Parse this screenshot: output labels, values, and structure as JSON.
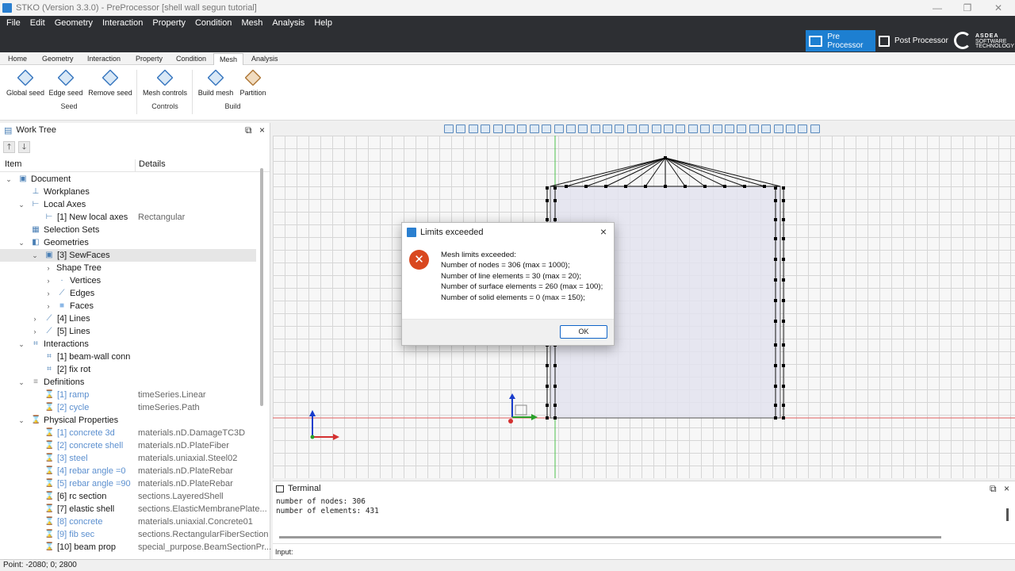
{
  "window": {
    "title": "STKO (Version 3.3.0) - PreProcessor [shell wall segun tutorial]"
  },
  "menu": [
    "File",
    "Edit",
    "Geometry",
    "Interaction",
    "Property",
    "Condition",
    "Mesh",
    "Analysis",
    "Help"
  ],
  "modes": {
    "pre": "Pre Processor",
    "post": "Post Processor"
  },
  "brand": {
    "line1": "ASDEA",
    "line2": "SOFTWARE",
    "line3": "TECHNOLOGY"
  },
  "ribbon": {
    "tabs": [
      "Home",
      "Geometry",
      "Interaction",
      "Property",
      "Condition",
      "Mesh",
      "Analysis"
    ],
    "active_tab": "Mesh",
    "buttons": {
      "global_seed": "Global seed",
      "edge_seed": "Edge seed",
      "remove_seed": "Remove seed",
      "mesh_controls": "Mesh controls",
      "build_mesh": "Build mesh",
      "partition": "Partition"
    },
    "groups": {
      "seed": "Seed",
      "controls": "Controls",
      "build": "Build"
    }
  },
  "worktree": {
    "title": "Work Tree",
    "col_item": "Item",
    "col_details": "Details",
    "rows": [
      {
        "name": "Document",
        "details": ""
      },
      {
        "name": "Workplanes",
        "details": ""
      },
      {
        "name": "Local Axes",
        "details": ""
      },
      {
        "name": "[1] New local axes",
        "details": "Rectangular"
      },
      {
        "name": "Selection Sets",
        "details": ""
      },
      {
        "name": "Geometries",
        "details": ""
      },
      {
        "name": "[3] SewFaces",
        "details": ""
      },
      {
        "name": "Shape Tree",
        "details": ""
      },
      {
        "name": "Vertices",
        "details": ""
      },
      {
        "name": "Edges",
        "details": ""
      },
      {
        "name": "Faces",
        "details": ""
      },
      {
        "name": "[4] Lines",
        "details": ""
      },
      {
        "name": "[5] Lines",
        "details": ""
      },
      {
        "name": "Interactions",
        "details": ""
      },
      {
        "name": "[1] beam-wall conn",
        "details": ""
      },
      {
        "name": "[2] fix rot",
        "details": ""
      },
      {
        "name": "Definitions",
        "details": ""
      },
      {
        "name": "[1] ramp",
        "details": "timeSeries.Linear"
      },
      {
        "name": "[2] cycle",
        "details": "timeSeries.Path"
      },
      {
        "name": "Physical Properties",
        "details": ""
      },
      {
        "name": "[1] concrete 3d",
        "details": "materials.nD.DamageTC3D"
      },
      {
        "name": "[2] concrete shell",
        "details": "materials.nD.PlateFiber"
      },
      {
        "name": "[3] steel",
        "details": "materials.uniaxial.Steel02"
      },
      {
        "name": "[4] rebar angle =0",
        "details": "materials.nD.PlateRebar"
      },
      {
        "name": "[5] rebar angle =90",
        "details": "materials.nD.PlateRebar"
      },
      {
        "name": "[6] rc section",
        "details": "sections.LayeredShell"
      },
      {
        "name": "[7] elastic shell",
        "details": "sections.ElasticMembranePlate..."
      },
      {
        "name": "[8] concrete",
        "details": "materials.uniaxial.Concrete01"
      },
      {
        "name": "[9] fib sec",
        "details": "sections.RectangularFiberSection"
      },
      {
        "name": "[10] beam prop",
        "details": "special_purpose.BeamSectionPr..."
      }
    ]
  },
  "dialog": {
    "title": "Limits exceeded",
    "heading": "Mesh limits exceeded:",
    "lines": [
      "Number of nodes = 306 (max = 1000);",
      "Number of line elements = 30 (max = 20);",
      "Number of surface elements = 260 (max = 100);",
      "Number of solid elements = 0 (max = 150);"
    ],
    "ok": "OK"
  },
  "terminal": {
    "title": "Terminal",
    "lines": [
      "number of nodes: 306",
      "number of elements: 431"
    ],
    "input_label": "Input:"
  },
  "status": {
    "point": "Point: -2080; 0; 2800"
  },
  "icons": {
    "close": "×",
    "restore": "⧉",
    "error": "✕",
    "up": "🡑",
    "down": "🡓",
    "chevron_right": "›",
    "chevron_down": "⌄"
  }
}
